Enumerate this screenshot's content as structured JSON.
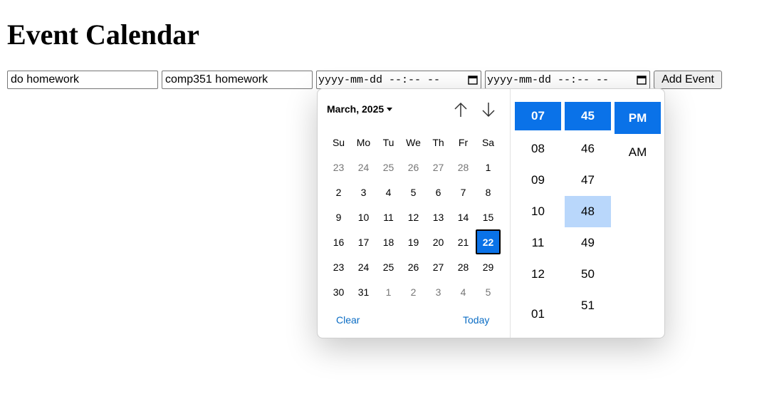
{
  "page": {
    "title": "Event Calendar"
  },
  "form": {
    "event_name": "do homework",
    "description": "comp351 homework",
    "start_placeholder": "yyyy-mm-dd --:-- --",
    "end_placeholder": "yyyy-mm-dd --:-- --",
    "add_label": "Add Event"
  },
  "picker": {
    "month_label": "March, 2025",
    "weekdays": [
      "Su",
      "Mo",
      "Tu",
      "We",
      "Th",
      "Fr",
      "Sa"
    ],
    "weeks": [
      [
        "23",
        "24",
        "25",
        "26",
        "27",
        "28",
        "1"
      ],
      [
        "2",
        "3",
        "4",
        "5",
        "6",
        "7",
        "8"
      ],
      [
        "9",
        "10",
        "11",
        "12",
        "13",
        "14",
        "15"
      ],
      [
        "16",
        "17",
        "18",
        "19",
        "20",
        "21",
        "22"
      ],
      [
        "23",
        "24",
        "25",
        "26",
        "27",
        "28",
        "29"
      ],
      [
        "30",
        "31",
        "1",
        "2",
        "3",
        "4",
        "5"
      ]
    ],
    "selected_day": "22",
    "clear_label": "Clear",
    "today_label": "Today",
    "hours": [
      "07",
      "08",
      "09",
      "10",
      "11",
      "12",
      "01"
    ],
    "minutes": [
      "45",
      "46",
      "47",
      "48",
      "49",
      "50",
      "51"
    ],
    "meridiem": [
      "PM",
      "AM"
    ],
    "selected_hour": "07",
    "selected_minute": "45",
    "hovered_minute": "48",
    "selected_meridiem": "PM",
    "colors": {
      "accent": "#0a72e8",
      "hover": "#b9d7fb",
      "link": "#0a6cc4",
      "muted": "#767676"
    }
  }
}
